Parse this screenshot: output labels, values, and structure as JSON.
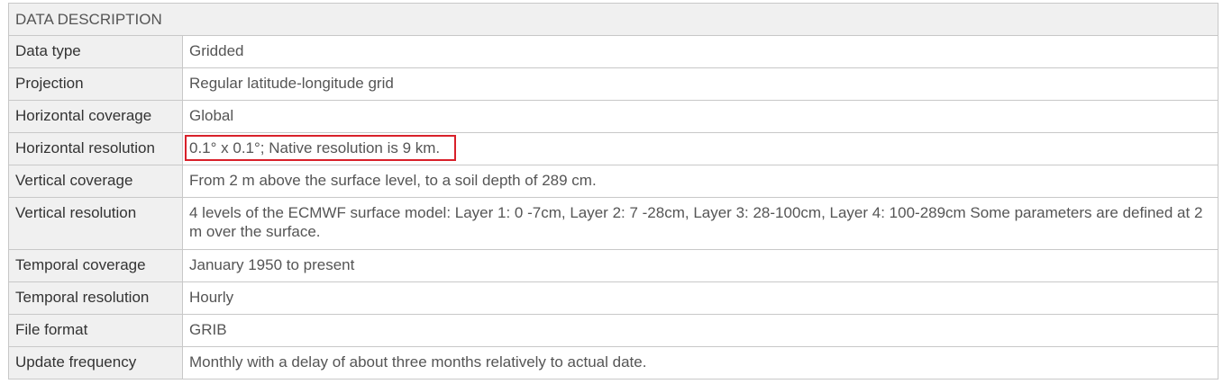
{
  "table": {
    "title": "DATA DESCRIPTION",
    "rows": [
      {
        "label": "Data type",
        "value": "Gridded"
      },
      {
        "label": "Projection",
        "value": "Regular latitude-longitude grid"
      },
      {
        "label": "Horizontal coverage",
        "value": "Global"
      },
      {
        "label": "Horizontal resolution",
        "value": "0.1° x 0.1°; Native resolution is 9 km.",
        "highlighted": true
      },
      {
        "label": "Vertical coverage",
        "value": "From 2 m above the surface level, to a soil depth of 289 cm."
      },
      {
        "label": "Vertical resolution",
        "value": "4 levels of the ECMWF surface model: Layer 1: 0 -7cm, Layer 2: 7 -28cm, Layer 3: 28-100cm, Layer 4: 100-289cm Some parameters are defined at 2 m over the surface."
      },
      {
        "label": "Temporal coverage",
        "value": "January 1950 to present"
      },
      {
        "label": "Temporal resolution",
        "value": "Hourly"
      },
      {
        "label": "File format",
        "value": "GRIB"
      },
      {
        "label": "Update frequency",
        "value": "Monthly with a delay of about three months relatively to actual date."
      }
    ]
  },
  "colors": {
    "header_bg": "#f0f0f0",
    "border": "#c8c8c8",
    "highlight_border": "#d8202a"
  }
}
